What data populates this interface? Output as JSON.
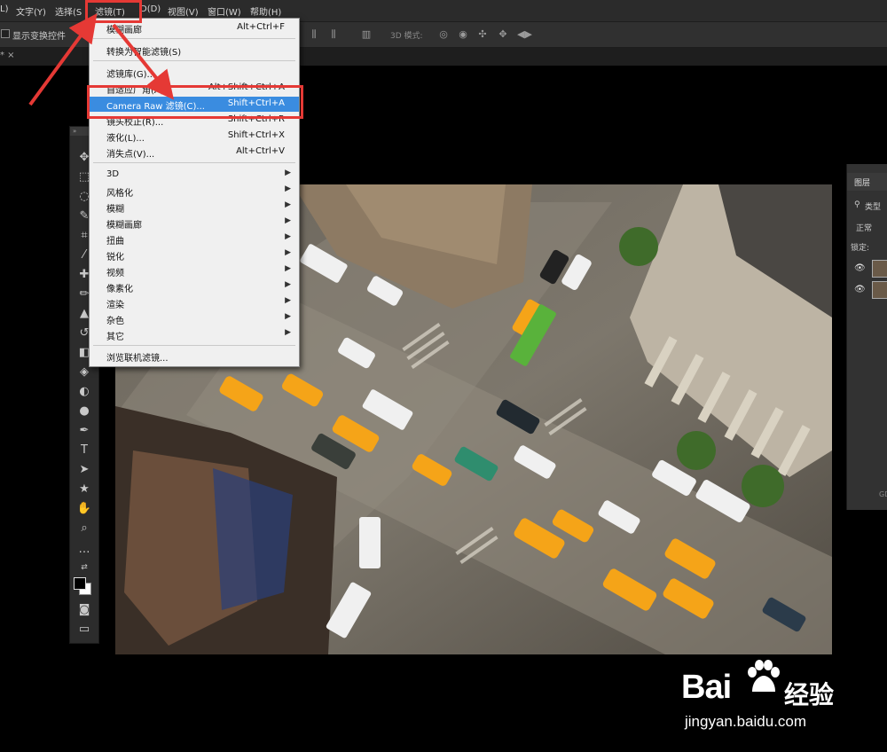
{
  "menubar": {
    "items": [
      "L)",
      "文字(Y)",
      "选择(S",
      "滤镜(T)",
      "D(D)",
      "视图(V)",
      "窗口(W)",
      "帮助(H)"
    ]
  },
  "options_bar": {
    "checkbox_label": "显示变换控件",
    "mode_3d_label": "3D 模式:"
  },
  "tabstrip": {
    "tab_text": "* ×"
  },
  "filter_menu": {
    "items": [
      {
        "label": "模糊画廊",
        "shortcut": "Alt+Ctrl+F"
      },
      {
        "label": "转换为智能滤镜(S)",
        "shortcut": ""
      },
      {
        "label": "滤镜库(G)...",
        "shortcut": ""
      },
      {
        "label": "自适应广角(A)...",
        "shortcut": "Alt+Shift+Ctrl+A"
      },
      {
        "label": "Camera Raw 滤镜(C)...",
        "shortcut": "Shift+Ctrl+A",
        "highlighted": true
      },
      {
        "label": "镜头校正(R)...",
        "shortcut": "Shift+Ctrl+R"
      },
      {
        "label": "液化(L)...",
        "shortcut": "Shift+Ctrl+X"
      },
      {
        "label": "消失点(V)...",
        "shortcut": "Alt+Ctrl+V"
      },
      {
        "label": "3D",
        "submenu": true
      },
      {
        "label": "风格化",
        "submenu": true
      },
      {
        "label": "模糊",
        "submenu": true
      },
      {
        "label": "模糊画廊",
        "submenu": true
      },
      {
        "label": "扭曲",
        "submenu": true
      },
      {
        "label": "锐化",
        "submenu": true
      },
      {
        "label": "视频",
        "submenu": true
      },
      {
        "label": "像素化",
        "submenu": true
      },
      {
        "label": "渲染",
        "submenu": true
      },
      {
        "label": "杂色",
        "submenu": true
      },
      {
        "label": "其它",
        "submenu": true
      },
      {
        "label": "浏览联机滤镜...",
        "shortcut": ""
      }
    ]
  },
  "layers_panel": {
    "tab": "图层",
    "filter_label": "类型",
    "blend_mode": "正常",
    "lock_label": "锁定:",
    "footer": "GD"
  },
  "watermark": {
    "logo_text": "Bai",
    "logo_cn": "经验",
    "url": "jingyan.baidu.com"
  },
  "colors": {
    "highlight": "#3a8ce0",
    "annotation_red": "#e53935",
    "menu_bg": "#f0f0f0",
    "ui_dark": "#2b2b2b"
  }
}
